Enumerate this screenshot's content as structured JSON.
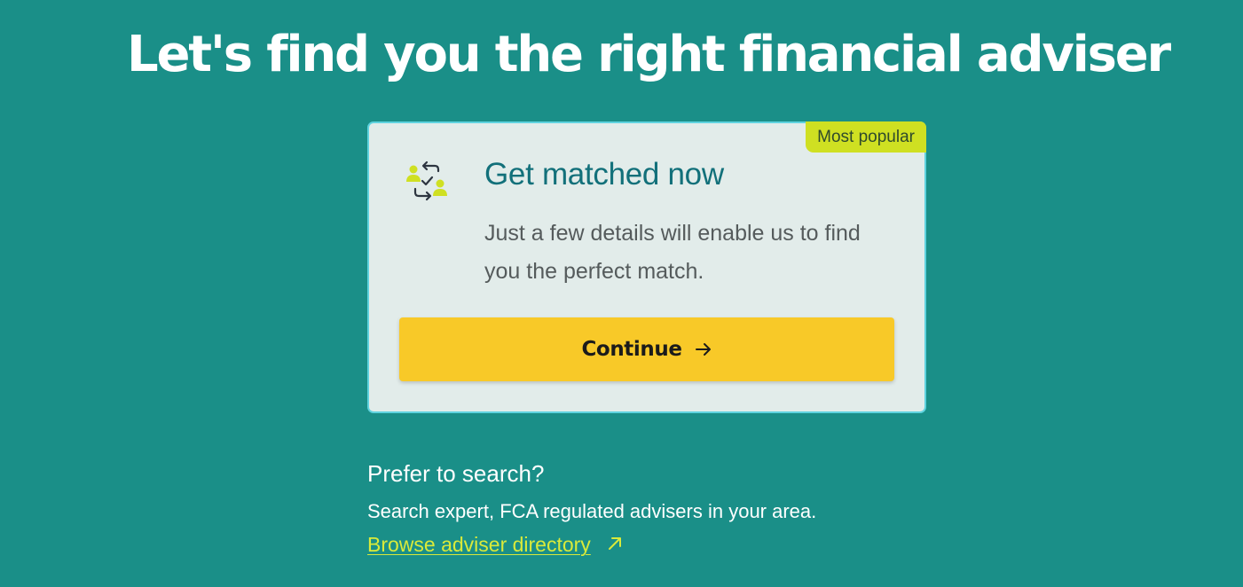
{
  "page": {
    "title": "Let's find you the right financial adviser"
  },
  "card": {
    "badge": "Most popular",
    "title": "Get matched now",
    "description": "Just a few details will enable us to find you the perfect match.",
    "icon": "match-people-icon",
    "button": {
      "label": "Continue",
      "icon": "arrow-right-icon"
    }
  },
  "search": {
    "heading": "Prefer to search?",
    "description": "Search expert, FCA regulated advisers in your area.",
    "link": {
      "label": "Browse adviser directory",
      "icon": "external-arrow-icon"
    }
  },
  "colors": {
    "background": "#1a8f88",
    "card_background": "#e2ecea",
    "card_border": "#5fd3df",
    "badge": "#cfe022",
    "button": "#f8c928",
    "card_title": "#12707a",
    "link": "#d9ea3a"
  }
}
